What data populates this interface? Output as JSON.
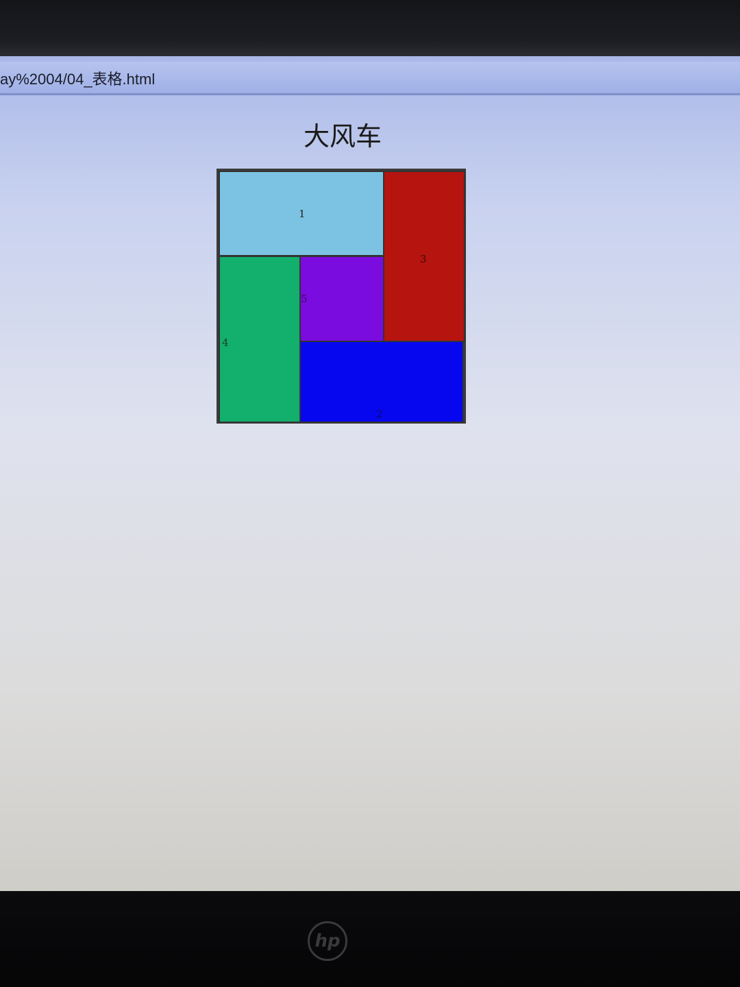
{
  "browser": {
    "address_text": "ay%2004/04_表格.html"
  },
  "page": {
    "title": "大风车"
  },
  "windmill_table": {
    "cells": [
      {
        "label": "1",
        "color": "#7cc3e3"
      },
      {
        "label": "2",
        "color": "#0707ef"
      },
      {
        "label": "3",
        "color": "#b5140f"
      },
      {
        "label": "4",
        "color": "#12b06c"
      },
      {
        "label": "5",
        "color": "#7a0ce0"
      }
    ]
  },
  "monitor": {
    "logo_icon": "hp-logo-icon",
    "logo_text": "hp"
  }
}
